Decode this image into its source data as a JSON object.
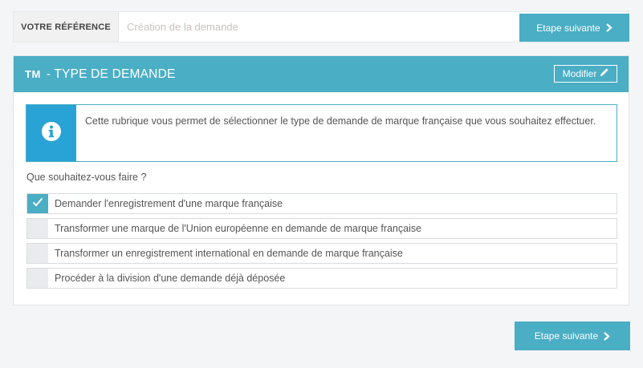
{
  "reference": {
    "label": "VOTRE RÉFÉRENCE",
    "placeholder": "Création de la demande",
    "value": ""
  },
  "next_button_label": "Etape suivante",
  "section": {
    "badge": "TM",
    "title": "- TYPE DE DEMANDE",
    "modify_label": "Modifier"
  },
  "info": {
    "text": "Cette rubrique vous permet de sélectionner le type de demande de marque française que vous souhaitez effectuer."
  },
  "question": "Que souhaitez-vous faire ?",
  "options": [
    {
      "label": "Demander l'enregistrement d'une marque française",
      "checked": true
    },
    {
      "label": "Transformer une marque de l'Union européenne en demande de marque française",
      "checked": false
    },
    {
      "label": "Transformer un enregistrement international en demande de marque française",
      "checked": false
    },
    {
      "label": "Procéder à la division d'une demande déjà déposée",
      "checked": false
    }
  ],
  "colors": {
    "accent": "#4aaec5",
    "info_icon_bg": "#29a3d6",
    "page_bg": "#f4f5f7"
  },
  "icons": {
    "next": "chevron-right-icon",
    "modify": "pencil-icon",
    "info": "info-circle-icon",
    "check": "check-icon"
  }
}
